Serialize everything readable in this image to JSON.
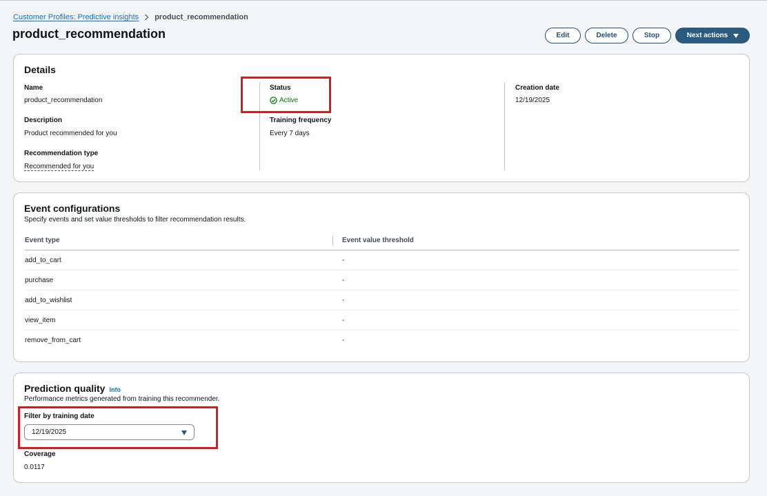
{
  "breadcrumb": {
    "parent": "Customer Profiles: Predictive insights",
    "current": "product_recommendation"
  },
  "page_title": "product_recommendation",
  "actions": {
    "edit": "Edit",
    "delete": "Delete",
    "stop": "Stop",
    "next_actions": "Next actions"
  },
  "details": {
    "title": "Details",
    "name_label": "Name",
    "name_value": "product_recommendation",
    "description_label": "Description",
    "description_value": "Product recommended for you",
    "rec_type_label": "Recommendation type",
    "rec_type_value": "Recommended for you",
    "status_label": "Status",
    "status_value": "Active",
    "training_freq_label": "Training frequency",
    "training_freq_value": "Every 7 days",
    "creation_label": "Creation date",
    "creation_value": "12/19/2025"
  },
  "events": {
    "title": "Event configurations",
    "description": "Specify events and set value thresholds to filter recommendation results.",
    "columns": [
      "Event type",
      "Event value threshold"
    ],
    "rows": [
      [
        "add_to_cart",
        "-"
      ],
      [
        "purchase",
        "-"
      ],
      [
        "add_to_wishlist",
        "-"
      ],
      [
        "view_item",
        "-"
      ],
      [
        "remove_from_cart",
        "-"
      ]
    ]
  },
  "prediction": {
    "title": "Prediction quality",
    "info": "Info",
    "description": "Performance metrics generated from training this recommender.",
    "filter_label": "Filter by training date",
    "filter_value": "12/19/2025",
    "coverage_label": "Coverage",
    "coverage_value": "0.0117"
  },
  "colors": {
    "link": "#0972d3",
    "primary_button": "#2a5a80",
    "status_active": "#037f0c",
    "annotation_box": "#d71c1c"
  },
  "icons": {
    "breadcrumb_separator": "chevron-right-icon",
    "status": "check-circle-icon",
    "dropdown": "caret-down-icon"
  }
}
